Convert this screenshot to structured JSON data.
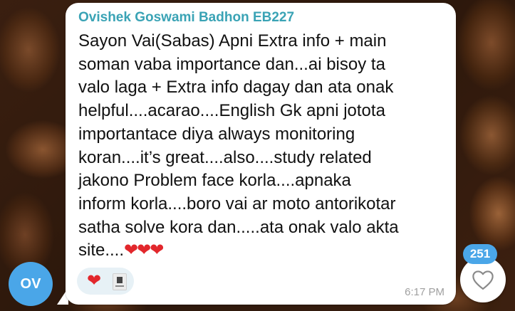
{
  "message": {
    "sender": "Ovishek Goswami Badhon EB227",
    "lines": [
      "Sayon Vai(Sabas) Apni Extra info +  main",
      "soman vaba importance dan...ai bisoy ta",
      "valo laga + Extra info dagay dan ata onak",
      "helpful....acarao....English Gk apni jotota",
      "importantace diya always monitoring",
      "koran....it’s great....also....study related",
      "jakono Problem  face korla....apnaka",
      "inform korla....boro vai ar moto antorikotar",
      "satha solve kora dan.....ata onak valo akta",
      "site...."
    ],
    "trailing_emoji": "❤❤❤",
    "time": "6:17 PM",
    "reaction_emoji": "❤"
  },
  "avatar": {
    "initials": "OV"
  },
  "like_button": {
    "count": "251",
    "icon": "heart-outline-icon"
  },
  "colors": {
    "sender": "#3aa3b5",
    "avatar_bg": "#4aa6e8",
    "heart": "#e2272c",
    "reaction_pill": "#e7f1f6"
  }
}
